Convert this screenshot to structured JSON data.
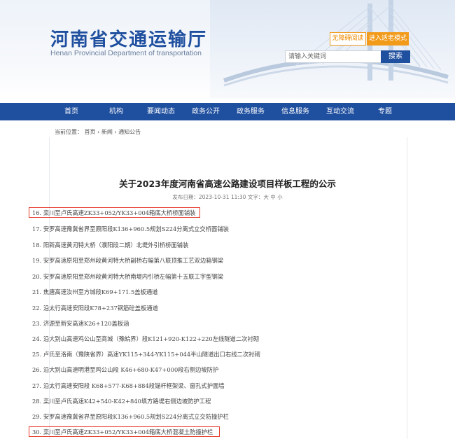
{
  "header": {
    "title": "河南省交通运输厅",
    "subtitle": "Henan Provincial Department of transportation",
    "accessibility_label": "无障碍阅读",
    "elder_mode_label": "进入适老模式",
    "search_placeholder": "请输入关键词",
    "search_button": "搜索"
  },
  "nav": {
    "items": [
      {
        "label": "首页"
      },
      {
        "label": "机构"
      },
      {
        "label": "要闻动态"
      },
      {
        "label": "政务公开"
      },
      {
        "label": "政务服务"
      },
      {
        "label": "信息服务"
      },
      {
        "label": "互动交流"
      },
      {
        "label": "专题"
      }
    ]
  },
  "breadcrumb": {
    "prefix": "当前位置：",
    "items": [
      "首页",
      "新闻",
      "通知公告"
    ],
    "separator": "›"
  },
  "article": {
    "title": "关于2023年度河南省高速公路建设项目样板工程的公示",
    "meta": "发布日期：2023-10-31 11:30   文字：大 中 小",
    "items": [
      "16. 栾川至卢氏高速ZK33+052/YK33+004箱底大桥桥面铺装",
      "17. 安罗高速豫冀省界至原阳段K136+960.5规划S224分离式立交桥面铺装",
      "18. 阳新高速黄河特大桥（濮阳段二期）北堤外引桥桥面铺装",
      "19. 安罗高速原阳至郑州段黄河特大桥副桥右幅第八联顶推工艺双边箱钢梁",
      "20. 安罗高速原阳至郑州段黄河特大桥南堤内引桥左幅第十五联工字型钢梁",
      "21. 焦唐高速汝州至方城段K69+171.5盖板通道",
      "22. 沿太行高速安阳段K78+237钢筋砼盖板通道",
      "23. 济源至新安高速K26+120盖板涵",
      "24. 沿大别山高速鸡公山至商城（豫皖界）段K121+920-K122+220左线隧道二次衬砌",
      "25. 卢氏至洛南（豫陕省界）高速YK115+344-YK115+044半山隧道出口右线二次衬砌",
      "26. 沿大别山高速明港至鸡公山段 K46+680-K47+000段右侧边坡防护",
      "27. 沿太行高速安阳段 K68+577-K68+884段锚杆框架梁、窗孔式护面墙",
      "28. 栾川至卢氏高速K42+540-K42+840填方路堤右侧边坡防护工程",
      "29. 安罗高速豫冀省界至原阳段K136+960.5规划S224分离式立交防撞护栏",
      "30. 栾川至卢氏高速ZK33+052/YK33+004箱底大桥混凝土防撞护栏"
    ]
  },
  "colors": {
    "brand_blue": "#1f4f9f",
    "accent_orange": "#f29a1a",
    "highlight_red": "#e53b2c"
  }
}
